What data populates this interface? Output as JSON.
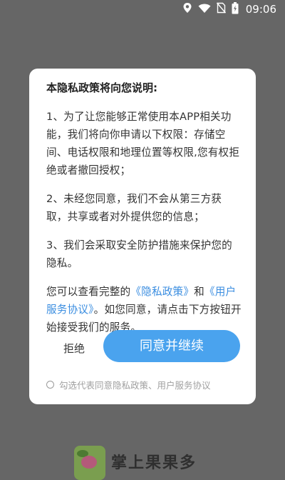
{
  "status_bar": {
    "time": "09:06",
    "icons": [
      "location-icon",
      "wifi-icon",
      "no-sim-icon",
      "battery-icon"
    ]
  },
  "dialog": {
    "title": "本隐私政策将向您说明:",
    "para1": "1、为了让您能够正常使用本APP相关功能，我们将向你申请以下权限：存储空间、电话权限和地理位置等权限,您有权拒绝或者撤回授权；",
    "para2": "2、未经您同意，我们不会从第三方获取，共享或者对外提供您的信息；",
    "para3": "3、我们会采取安全防护措施来保护您的隐私。",
    "para4": {
      "prefix": "您可以查看完整的",
      "privacy_link": "《隐私政策》",
      "and": "和",
      "service_link": "《用户服务协议》",
      "suffix": "。如您同意，请点击下方按钮开始接受我们的服务。"
    },
    "reject_label": "拒绝",
    "agree_label": "同意并继续",
    "consent_label": "勾选代表同意隐私政策、用户服务协议",
    "consent_checked": false
  },
  "background_app": {
    "name": "掌上果果多"
  },
  "colors": {
    "overlay": "#666666",
    "accent": "#4aa3ee",
    "link": "#3a8de0"
  }
}
